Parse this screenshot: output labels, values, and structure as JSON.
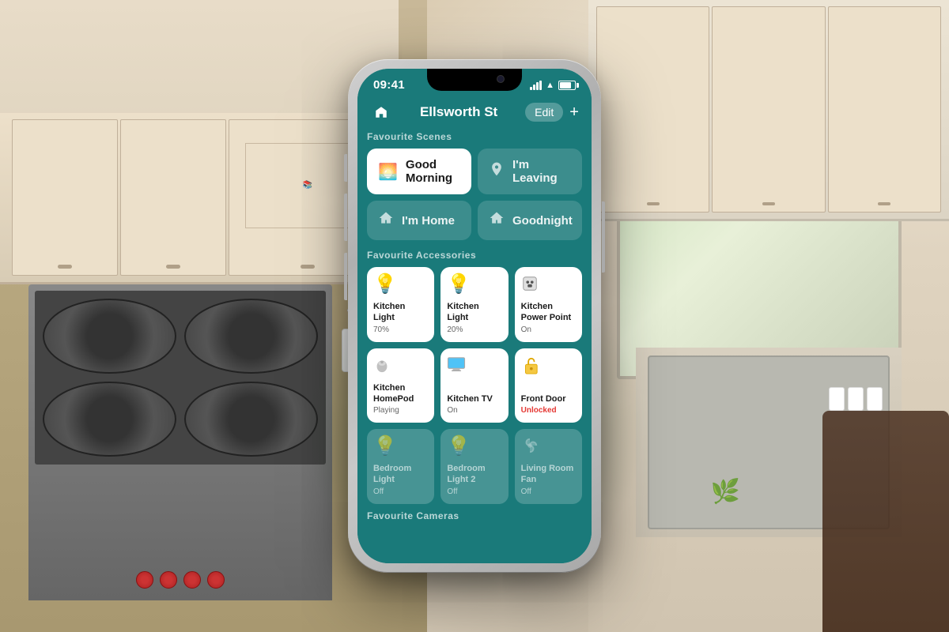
{
  "background": {
    "description": "Kitchen background"
  },
  "phone": {
    "statusBar": {
      "time": "09:41",
      "signal": true,
      "wifi": true,
      "battery": true
    },
    "navBar": {
      "homeIcon": "🏠",
      "title": "Ellsworth St",
      "editLabel": "Edit",
      "addLabel": "+"
    },
    "sections": {
      "scenes": {
        "sectionLabel": "Favourite Scenes",
        "items": [
          {
            "id": "good-morning",
            "name": "Good Morning",
            "icon": "🌅",
            "active": true
          },
          {
            "id": "im-leaving",
            "name": "I'm Leaving",
            "icon": "🏃",
            "active": false
          },
          {
            "id": "im-home",
            "name": "I'm Home",
            "icon": "🏠",
            "active": false
          },
          {
            "id": "goodnight",
            "name": "Goodnight",
            "icon": "🌙",
            "active": false
          }
        ]
      },
      "accessories": {
        "sectionLabel": "Favourite Accessories",
        "items": [
          {
            "id": "kitchen-light-1",
            "name": "Kitchen Light",
            "status": "70%",
            "icon": "💡",
            "on": true
          },
          {
            "id": "kitchen-light-2",
            "name": "Kitchen Light",
            "status": "20%",
            "icon": "💡",
            "on": true
          },
          {
            "id": "kitchen-power",
            "name": "Kitchen Power Point",
            "status": "On",
            "icon": "🔌",
            "on": true
          },
          {
            "id": "kitchen-homepod",
            "name": "Kitchen HomePod",
            "status": "Playing",
            "icon": "⏺",
            "on": true
          },
          {
            "id": "kitchen-tv",
            "name": "Kitchen TV",
            "status": "On",
            "icon": "📺",
            "on": true
          },
          {
            "id": "front-door",
            "name": "Front Door",
            "status": "Unlocked",
            "icon": "🔓",
            "on": true,
            "alert": true
          }
        ]
      },
      "offAccessories": {
        "items": [
          {
            "id": "bedroom-light",
            "name": "Bedroom Light",
            "status": "Off",
            "icon": "💡",
            "on": false
          },
          {
            "id": "bedroom-light-2",
            "name": "Bedroom Light 2",
            "status": "Off",
            "icon": "💡",
            "on": false
          },
          {
            "id": "living-room-fan",
            "name": "Living Room Fan",
            "status": "Off",
            "icon": "🌀",
            "on": false
          }
        ]
      },
      "cameras": {
        "sectionLabel": "Favourite Cameras"
      }
    }
  }
}
